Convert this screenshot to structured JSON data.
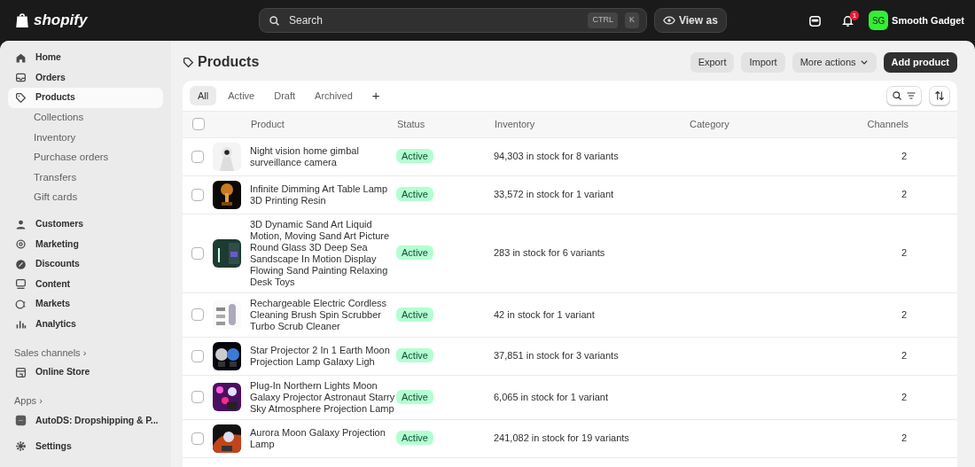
{
  "topbar": {
    "logo": "shopify",
    "search": {
      "placeholder": "Search",
      "shortcut": [
        "CTRL",
        "K"
      ]
    },
    "view_as": "View as",
    "notifications": {
      "count": "1"
    },
    "store": {
      "initials": "SG",
      "name": "Smooth Gadget"
    }
  },
  "sidebar": {
    "items": [
      {
        "label": "Home",
        "selected": false
      },
      {
        "label": "Orders",
        "selected": false
      },
      {
        "label": "Products",
        "selected": true,
        "children": [
          {
            "label": "Collections",
            "selected": false
          },
          {
            "label": "Inventory",
            "selected": false
          },
          {
            "label": "Purchase orders",
            "selected": false
          },
          {
            "label": "Transfers",
            "selected": false
          },
          {
            "label": "Gift cards",
            "selected": false
          }
        ]
      },
      {
        "label": "Customers",
        "selected": false
      },
      {
        "label": "Marketing",
        "selected": false
      },
      {
        "label": "Discounts",
        "selected": false
      },
      {
        "label": "Content",
        "selected": false
      },
      {
        "label": "Markets",
        "selected": false
      },
      {
        "label": "Analytics",
        "selected": false
      }
    ],
    "sections": [
      {
        "title": "Sales channels ›",
        "items": [
          {
            "label": "Online Store",
            "selected": false
          }
        ]
      },
      {
        "title": "Apps ›",
        "items": [
          {
            "label": "AutoDS: Dropshipping & P...",
            "selected": false
          }
        ]
      }
    ],
    "settings": "Settings"
  },
  "page": {
    "title": "Products",
    "actions": [
      "Export",
      "Import",
      "More actions"
    ],
    "primary_action": "Add product"
  },
  "tabs": [
    {
      "label": "All",
      "selected": true
    },
    {
      "label": "Active",
      "selected": false
    },
    {
      "label": "Draft",
      "selected": false
    },
    {
      "label": "Archived",
      "selected": false
    }
  ],
  "add_tab": "+",
  "table": {
    "select_all_checked": false,
    "columns": [
      "Product",
      "Status",
      "Inventory",
      "Category",
      "Channels"
    ],
    "rows": [
      {
        "selected": false,
        "product": "Night vision home gimbal surveillance camera",
        "status": "Active",
        "inventory": "94,303 in stock for 8 variants",
        "channels": "2"
      },
      {
        "selected": false,
        "product": "Infinite Dimming Art Table Lamp 3D Printing Resin",
        "status": "Active",
        "inventory": "33,572 in stock for 1 variant",
        "channels": "2"
      },
      {
        "selected": false,
        "product": "3D Dynamic Sand Art Liquid Motion, Moving Sand Art Picture Round Glass 3D Deep Sea Sandscape In Motion Display Flowing Sand Painting Relaxing Desk Toys",
        "status": "Active",
        "inventory": "283 in stock for 6 variants",
        "channels": "2"
      },
      {
        "selected": false,
        "product": "Rechargeable Electric Cordless Cleaning Brush Spin Scrubber Turbo Scrub Cleaner",
        "status": "Active",
        "inventory": "42 in stock for 1 variant",
        "channels": "2"
      },
      {
        "selected": false,
        "product": "Star Projector 2 In 1 Earth Moon Projection Lamp Galaxy Ligh",
        "status": "Active",
        "inventory": "37,851 in stock for 3 variants",
        "channels": "2"
      },
      {
        "selected": false,
        "product": "Plug-In Northern Lights Moon Galaxy Projector Astronaut Starry Sky Atmosphere Projection Lamp",
        "status": "Active",
        "inventory": "6,065 in stock for 1 variant",
        "channels": "2"
      },
      {
        "selected": false,
        "product": "Aurora Moon Galaxy Projection Lamp",
        "status": "Active",
        "inventory": "241,082 in stock for 19 variants",
        "channels": "2"
      }
    ]
  }
}
